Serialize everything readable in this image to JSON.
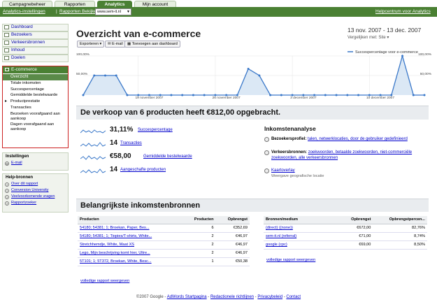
{
  "tabs": [
    "Campagnebeheer",
    "Rapporten",
    "Analytics",
    "Mijn account"
  ],
  "navbar": {
    "settings_link": "Analytics-instellingen",
    "separator": "|",
    "reports_link": "Rapporten Bekijken:",
    "site_select": "www.sem-it.nl",
    "help_link": "Helpcentrum voor Analytics"
  },
  "sidebar": {
    "items": [
      "Dashboard",
      "Bezoekers",
      "Verkeersbronnen",
      "Inhoud",
      "Doelen"
    ],
    "ecommerce": {
      "label": "E-commerce",
      "selected": "Overzicht",
      "subitems": [
        "Totale inkomsten",
        "Succespercentage",
        "Gemiddelde bestelwaarde",
        "Productprestatie",
        "Transacties"
      ],
      "multi": [
        "Bezoeken voorafgaand aan aankoop",
        "Dagen voorafgaand aan aankoop"
      ]
    },
    "settings": {
      "title": "Instellingen",
      "email": "E-mail"
    },
    "help": {
      "title": "Help-bronnen",
      "links": [
        "Over dit rapport",
        "Conversion University",
        "Veelvoorkomende vragen",
        "Rapportzoeker"
      ]
    }
  },
  "header": {
    "title": "Overzicht van e-commerce",
    "date_range": "13 nov. 2007 - 13 dec. 2007",
    "compare_label": "Vergelijken met: Site",
    "buttons": {
      "export": "Exporteren",
      "email": "E-mail",
      "add_dashboard": "Toevoegen aan dashboard"
    }
  },
  "chart_data": {
    "type": "area",
    "legend": "Succespercentage voor e-commerce",
    "y_ticks_left": [
      "100,00%",
      "50,00%"
    ],
    "y_ticks_right": [
      "100,00%",
      "50,00%"
    ],
    "x_tick_labels": [
      "19 november 2007",
      "26 november 2007",
      "3 december 2007",
      "10 december 2007"
    ],
    "ylim": [
      0,
      100
    ],
    "values": [
      0,
      50,
      50,
      50,
      0,
      0,
      0,
      0,
      0,
      0,
      0,
      0,
      0,
      0,
      0,
      67,
      50,
      0,
      0,
      0,
      0,
      0,
      0,
      0,
      0,
      0,
      0,
      0,
      0,
      100,
      0,
      0
    ]
  },
  "sales": {
    "headline": "De verkoop van 6 producten heeft €812,00 opgebracht.",
    "metrics": [
      {
        "value": "31,11%",
        "label": "Succespercentage"
      },
      {
        "value": "14",
        "label": "Transacties"
      },
      {
        "value": "€58,00",
        "label": "Gemiddelde bestelwaarde"
      },
      {
        "value": "14",
        "label": "Aangeschafte producten"
      }
    ]
  },
  "analysis": {
    "title": "Inkomstenanalyse",
    "visitor_profile_label": "Bezoekersprofiel:",
    "visitor_profile_links": "talen, netwerklocaties, door de gebruiker gedefinieerd",
    "traffic_label": "Verkeersbronnen:",
    "traffic_links": "zoekwoorden, betaalde zoekwoorden, niet-commerciële zoekwoorden, alle verkeersbronnen",
    "map_link": "Kaartoverlay",
    "map_sub": "Weergave geografische locatie"
  },
  "sources": {
    "headline": "Belangrijkste inkomstenbronnen",
    "products": {
      "headers": [
        "Producten",
        "Producten",
        "Opbrengst"
      ],
      "rows": [
        [
          "54180; 54381; 1; Broekan, Paper, Bes...",
          "6",
          "€352,69"
        ],
        [
          "54180; 54381; 1; Tiopies/T-shirts, White...",
          "2",
          "€46,97"
        ],
        [
          "Stretchhemdje, White, Maat XS",
          "2",
          "€46,97"
        ],
        [
          "Lego, Mijn beschrijving komt hier, Ultre...",
          "2",
          "€46,97"
        ],
        [
          "5T101; 1; 5T372, Broekan, White, Besc...",
          "1",
          "€50,38"
        ]
      ],
      "more": "volledige rapport weergeven"
    },
    "media": {
      "headers": [
        "Bronnen/medium",
        "Opbrengst",
        "Opbrengstpercen..."
      ],
      "rows": [
        [
          "(direct) ((none))",
          "€672,00",
          "82,76%"
        ],
        [
          "sem-it.nl (referral)",
          "€71,00",
          "8,74%"
        ],
        [
          "google (cpc)",
          "€69,00",
          "8,50%"
        ]
      ],
      "more": "volledige rapport weergeven"
    }
  },
  "footer": {
    "copyright": "©2007 Google -",
    "links": [
      "AdWords Startpagina",
      "Redactionele richtlijnen",
      "Privacybeleid",
      "Contact"
    ]
  }
}
